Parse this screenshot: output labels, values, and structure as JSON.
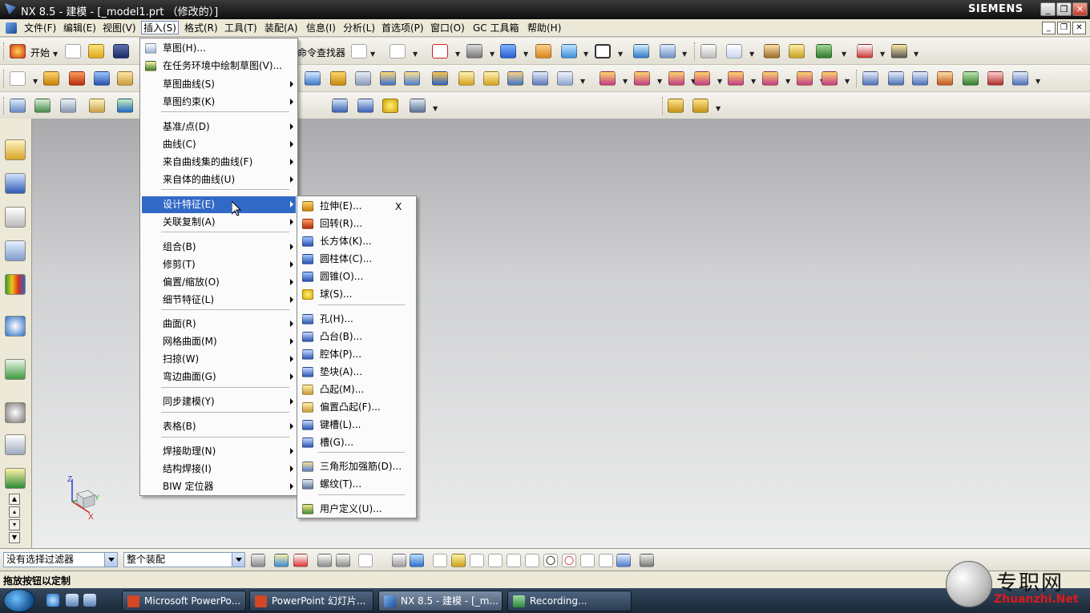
{
  "window": {
    "title": "NX 8.5 - 建模 - [_model1.prt （修改的）]",
    "brand": "SIEMENS",
    "controls": [
      "_",
      "❐",
      "✕"
    ]
  },
  "menubar": {
    "items": [
      "文件(F)",
      "编辑(E)",
      "视图(V)",
      "插入(S)",
      "格式(R)",
      "工具(T)",
      "装配(A)",
      "信息(I)",
      "分析(L)",
      "首选项(P)",
      "窗口(O)",
      "GC 工具箱",
      "帮助(H)"
    ],
    "active_index": 3
  },
  "toolbar": {
    "start_label": "开始",
    "command_finder_label": "命令查找器"
  },
  "insert_menu": {
    "items": [
      {
        "label": "草图(H)...",
        "icon": "sketch-icon",
        "submenu": false
      },
      {
        "label": "在任务环境中绘制草图(V)...",
        "icon": "sketch-task-icon",
        "submenu": false
      },
      {
        "label": "草图曲线(S)",
        "submenu": true
      },
      {
        "label": "草图约束(K)",
        "submenu": true
      },
      {
        "label": "基准/点(D)",
        "submenu": true
      },
      {
        "label": "曲线(C)",
        "submenu": true
      },
      {
        "label": "来自曲线集的曲线(F)",
        "submenu": true
      },
      {
        "label": "来自体的曲线(U)",
        "submenu": true
      },
      {
        "label": "设计特征(E)",
        "submenu": true,
        "highlighted": true
      },
      {
        "label": "关联复制(A)",
        "submenu": true
      },
      {
        "label": "组合(B)",
        "submenu": true
      },
      {
        "label": "修剪(T)",
        "submenu": true
      },
      {
        "label": "偏置/缩放(O)",
        "submenu": true
      },
      {
        "label": "细节特征(L)",
        "submenu": true
      },
      {
        "label": "曲面(R)",
        "submenu": true
      },
      {
        "label": "网格曲面(M)",
        "submenu": true
      },
      {
        "label": "扫掠(W)",
        "submenu": true
      },
      {
        "label": "弯边曲面(G)",
        "submenu": true
      },
      {
        "label": "同步建模(Y)",
        "submenu": true
      },
      {
        "label": "表格(B)",
        "submenu": true
      },
      {
        "label": "焊接助理(N)",
        "submenu": true
      },
      {
        "label": "结构焊接(I)",
        "submenu": true
      },
      {
        "label": "BIW 定位器",
        "submenu": true
      }
    ]
  },
  "design_feature_menu": {
    "close_label": "X",
    "items": [
      {
        "label": "拉伸(E)...",
        "icon": "extrude-icon"
      },
      {
        "label": "回转(R)...",
        "icon": "revolve-icon"
      },
      {
        "label": "长方体(K)...",
        "icon": "block-icon"
      },
      {
        "label": "圆柱体(C)...",
        "icon": "cylinder-icon"
      },
      {
        "label": "圆锥(O)...",
        "icon": "cone-icon"
      },
      {
        "label": "球(S)...",
        "icon": "sphere-icon"
      },
      {
        "label": "孔(H)...",
        "icon": "hole-icon"
      },
      {
        "label": "凸台(B)...",
        "icon": "boss-icon"
      },
      {
        "label": "腔体(P)...",
        "icon": "pocket-icon"
      },
      {
        "label": "垫块(A)...",
        "icon": "pad-icon"
      },
      {
        "label": "凸起(M)...",
        "icon": "emboss-icon"
      },
      {
        "label": "偏置凸起(F)...",
        "icon": "offset-emboss-icon"
      },
      {
        "label": "键槽(L)...",
        "icon": "slot-icon"
      },
      {
        "label": "槽(G)...",
        "icon": "groove-icon"
      },
      {
        "label": "三角形加强筋(D)...",
        "icon": "dart-icon"
      },
      {
        "label": "螺纹(T)...",
        "icon": "thread-icon"
      },
      {
        "label": "用户定义(U)...",
        "icon": "user-defined-icon"
      }
    ]
  },
  "triad": {
    "z": "Z",
    "x": "X",
    "y": "Y"
  },
  "selection_bar": {
    "filter_value": "没有选择过滤器",
    "scope_value": "整个装配"
  },
  "status": {
    "text": "拖放按钮以定制"
  },
  "taskbar": {
    "tasks": [
      {
        "label": "Microsoft PowerPo...",
        "active": false
      },
      {
        "label": "PowerPoint 幻灯片...",
        "active": false
      },
      {
        "label": "NX 8.5 - 建模 - [_m...",
        "active": true
      },
      {
        "label": "Recording...",
        "active": false
      }
    ]
  },
  "watermark": {
    "cn": "专职网",
    "en": "Zhuanzhi.Net"
  },
  "colors": {
    "menu_highlight": "#3169c6",
    "titlebar": "#1a1a1a",
    "viewport_top": "#a9aaac",
    "viewport_bottom": "#eceded"
  }
}
